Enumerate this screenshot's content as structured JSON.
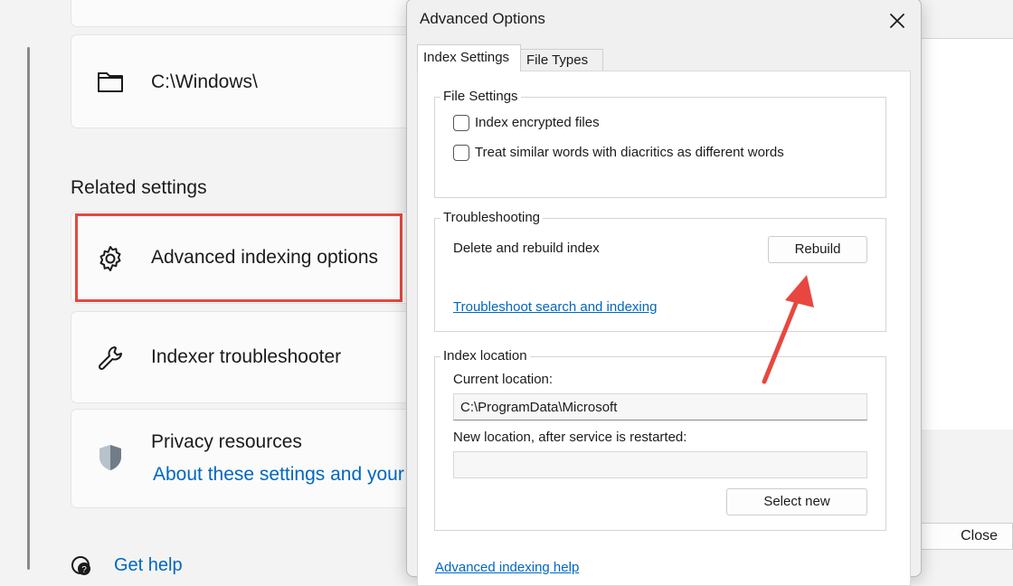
{
  "settings": {
    "folder_path": "C:\\Windows\\",
    "related_heading": "Related settings",
    "advanced_indexing": "Advanced indexing options",
    "indexer_troubleshooter": "Indexer troubleshooter",
    "privacy_title": "Privacy resources",
    "privacy_link": "About these settings and your",
    "get_help": "Get help"
  },
  "background_window": {
    "close_label": "Close"
  },
  "dialog": {
    "title": "Advanced Options",
    "tabs": [
      {
        "label": "Index Settings",
        "active": true
      },
      {
        "label": "File Types",
        "active": false
      }
    ],
    "file_settings": {
      "legend": "File Settings",
      "encrypted_label": "Index encrypted files",
      "encrypted_checked": false,
      "diacritics_label": "Treat similar words with diacritics as different words",
      "diacritics_checked": false
    },
    "troubleshooting": {
      "legend": "Troubleshooting",
      "delete_rebuild_label": "Delete and rebuild index",
      "rebuild_button": "Rebuild",
      "troubleshoot_link": "Troubleshoot search and indexing"
    },
    "index_location": {
      "legend": "Index location",
      "current_label": "Current location:",
      "current_value": "C:\\ProgramData\\Microsoft",
      "new_label": "New location, after service is restarted:",
      "new_value": "",
      "select_new_button": "Select new"
    },
    "help_link": "Advanced indexing help"
  },
  "colors": {
    "accent_link": "#0067c0",
    "highlight_box": "#e8473f",
    "annotation_arrow": "#e8473f"
  }
}
